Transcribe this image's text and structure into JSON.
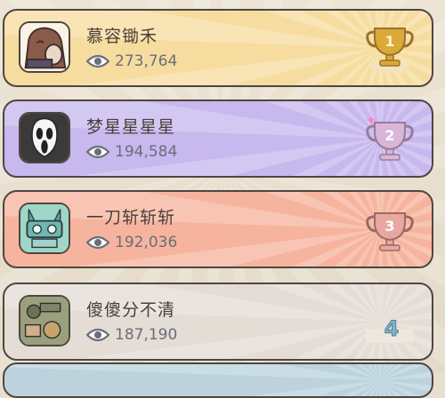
{
  "leaderboard": {
    "entries": [
      {
        "rank": "1",
        "name": "慕容锄禾",
        "views": "273,764",
        "medal": "gold-trophy-icon",
        "card_color": "#f6dc9f"
      },
      {
        "rank": "2",
        "name": "梦星星星星",
        "views": "194,584",
        "medal": "silver-trophy-icon",
        "card_color": "#c7b8ee"
      },
      {
        "rank": "3",
        "name": "一刀斩斩斩",
        "views": "192,036",
        "medal": "bronze-trophy-icon",
        "card_color": "#f6b49e"
      },
      {
        "rank": "4",
        "name": "傻傻分不清",
        "views": "187,190",
        "medal": "rank-badge",
        "card_color": "#e4ddd6"
      }
    ]
  }
}
